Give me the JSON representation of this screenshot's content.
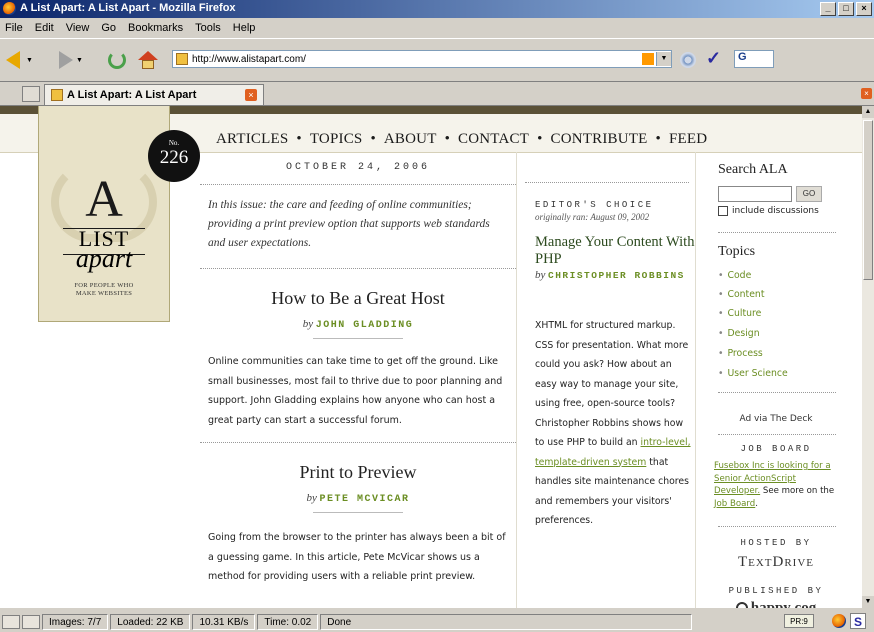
{
  "window": {
    "title": "A List Apart: A List Apart - Mozilla Firefox",
    "controls": [
      "_",
      "□",
      "×"
    ]
  },
  "menu": [
    "File",
    "Edit",
    "View",
    "Go",
    "Bookmarks",
    "Tools",
    "Help"
  ],
  "toolbar": {
    "url": "http://www.alistapart.com/",
    "search_value": "G"
  },
  "tabs": [
    {
      "label": "A List Apart: A List Apart",
      "active": true
    }
  ],
  "site": {
    "nav": [
      "ARTICLES",
      "TOPICS",
      "ABOUT",
      "CONTACT",
      "CONTRIBUTE",
      "FEED"
    ],
    "nav_separator": "•",
    "logo": {
      "big_letter": "A",
      "list": "LIST",
      "apart": "apart",
      "tagline_1": "FOR PEOPLE WHO",
      "tagline_2": "MAKE WEBSITES"
    },
    "issue": {
      "label": "No.",
      "number": "226"
    },
    "date": "OCTOBER 24, 2006",
    "intro": "In this issue: the care and feeding of online communities; providing a print preview option that supports web standards and user expectations.",
    "articles": [
      {
        "title": "How to Be a Great Host",
        "by": "by",
        "author": "JOHN GLADDING",
        "body": "Online communities can take time to get off the ground. Like small businesses, most fail to thrive due to poor planning and support. John Gladding explains how anyone who can host a great party can start a successful forum."
      },
      {
        "title": "Print to Preview",
        "by": "by",
        "author": "PETE MCVICAR",
        "body": "Going from the browser to the printer has always been a bit of a guessing game. In this article, Pete McVicar shows us a method for providing users with a reliable print preview."
      }
    ],
    "editors_choice": {
      "heading": "EDITOR'S CHOICE",
      "original": "originally ran: August 09, 2002",
      "title": "Manage Your Content With PHP",
      "by": "by",
      "author": "CHRISTOPHER ROBBINS",
      "body_1": "XHTML for structured markup. CSS for presentation. What more could you ask? How about an easy way to manage your site, using free, open-source tools? Christopher Robbins shows how to use PHP to build an",
      "link": "intro-level, template-driven system",
      "body_2": "that handles site maintenance chores and remembers your visitors' preferences."
    },
    "sidebar": {
      "search_title": "Search ALA",
      "search_button": "GO",
      "include_label": "include discussions",
      "topics_title": "Topics",
      "topics": [
        "Code",
        "Content",
        "Culture",
        "Design",
        "Process",
        "User Science"
      ],
      "ad_via": "Ad via The Deck",
      "job_board_heading": "JOB BOARD",
      "job_link": "Fusebox Inc is looking for a Senior ActionScript Developer.",
      "job_more": "See more on the",
      "job_board_link": "Job Board",
      "job_end": ".",
      "hosted_by": "HOSTED BY",
      "host_name": "TextDrive",
      "published_by": "PUBLISHED BY",
      "publisher": "happy cog"
    }
  },
  "status": {
    "images": "Images: 7/7",
    "loaded": "Loaded: 22 KB",
    "speed": "10.31 KB/s",
    "time": "Time: 0.02",
    "state": "Done",
    "pr": "PR:9"
  },
  "colors": {
    "accent_green": "#6b8e23",
    "band": "#5b5137",
    "logo_bg": "#e8e2c8"
  }
}
